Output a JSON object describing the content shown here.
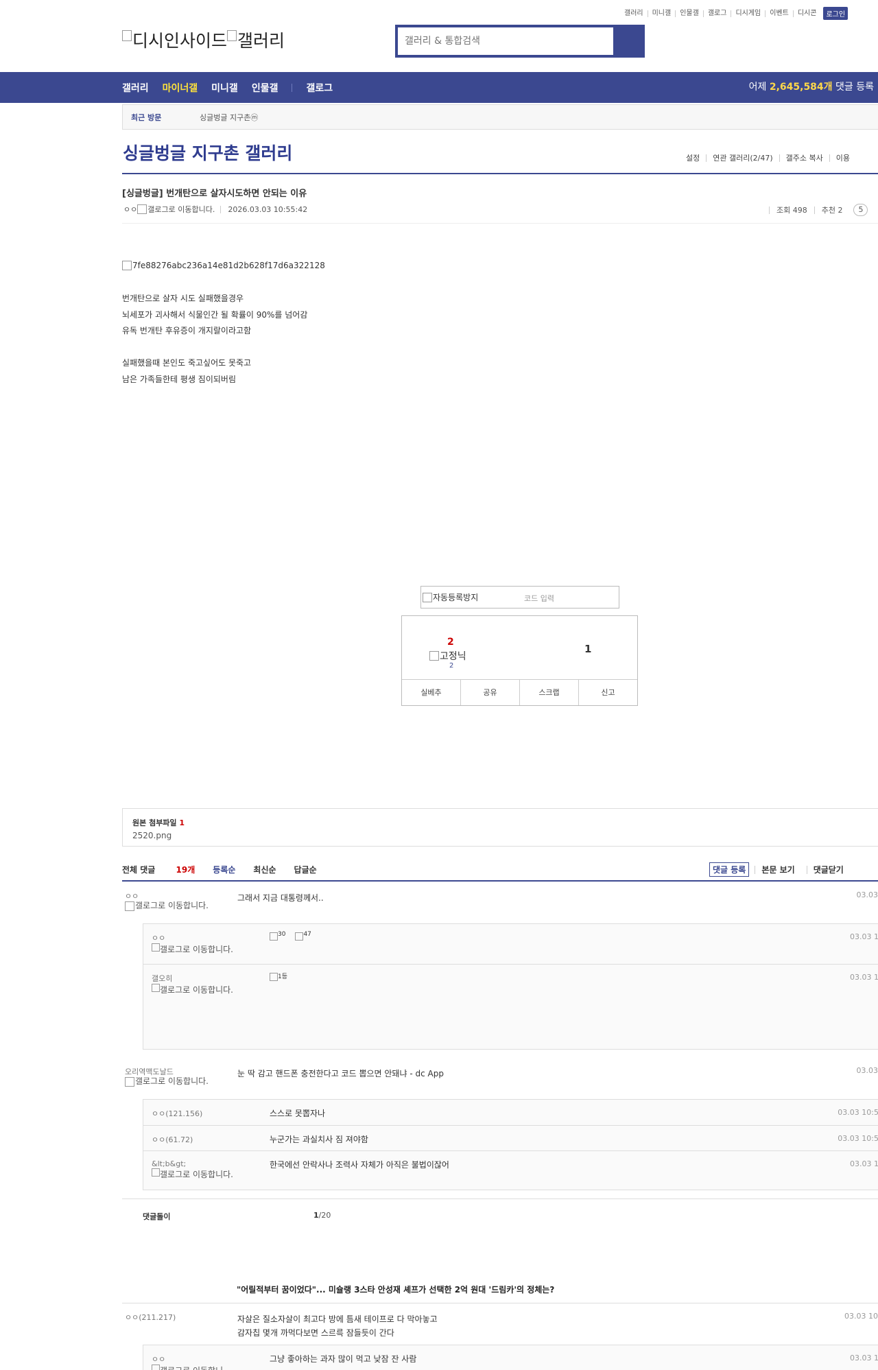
{
  "util": {
    "items": [
      "갤러리",
      "미니갤",
      "인물갤",
      "갤로그",
      "디시게임",
      "이벤트",
      "디시콘"
    ],
    "login": "로그인"
  },
  "logo": {
    "left": "디시인사이드",
    "right": "갤러리"
  },
  "search": {
    "placeholder": "갤러리 & 통합검색"
  },
  "gnb": {
    "items": [
      "갤러리",
      "마이너갤",
      "미니갤",
      "인물갤",
      "갤로그"
    ],
    "count_prefix": "어제",
    "count_value": "2,645,584개",
    "count_suffix": "댓글 등록"
  },
  "recent": {
    "label": "최근 방문",
    "value": "싱글벙글 지구촌",
    "badge": "ⓜ"
  },
  "gallery": {
    "title": "싱글벙글 지구촌 갤러리",
    "opts": [
      "설정",
      "연관 갤러리(2/47)",
      "갤주소 복사",
      "이용"
    ]
  },
  "post": {
    "title": "[싱글벙글] 번개탄으로 살자시도하면 안되는 이유",
    "author": "ㅇㅇ",
    "author_img_alt": "갤로그로 이동합니다.",
    "date": "2026.03.03 10:55:42",
    "views": "조회 498",
    "recommend": "추천 2",
    "comments_badge": "5",
    "image_alt": "7fe88276abc236a14e81d2b628f17d6a322128",
    "lines": [
      "번개탄으로 살자 시도 실패했을경우",
      "뇌세포가 괴사해서 식물인간 될 확률이 90%를 넘어감",
      "유독 번개탄 후유증이 개지랄이라고함",
      "",
      "실패했을때 본인도 죽고싶어도 못죽고",
      "남은 가족들한테 평생 짐이되버림"
    ]
  },
  "captcha": {
    "alt": "자동등록방지",
    "placeholder": "코드 입력"
  },
  "recommend_box": {
    "up": "2",
    "fixed_alt": "고정닉",
    "fixed": "2",
    "down": "1",
    "buttons": [
      "실베추",
      "공유",
      "스크랩",
      "신고"
    ]
  },
  "attach": {
    "title": "원본 첨부파일",
    "count": "1",
    "file": "2520.png"
  },
  "comment_bar": {
    "total_label": "전체 댓글",
    "total": "19개",
    "sorts": [
      "등록순",
      "최신순",
      "답글순"
    ],
    "register": "댓글 등록",
    "view": "본문 보기",
    "close": "댓글닫기"
  },
  "comments": [
    {
      "nick": "ㅇㅇ",
      "galog": "갤로그로 이동합니다.",
      "text": "그래서 지금 대통령께서..",
      "date": "03.03",
      "replies": [
        {
          "nick": "ㅇㅇ",
          "galog": "갤로그로 이동합니다.",
          "text": "",
          "dccon": [
            "30",
            "47"
          ],
          "date": "03.03 1"
        },
        {
          "nick": "갤오히",
          "galog": "갤로그로 이동합니다.",
          "text": "",
          "dccon": [
            "1등"
          ],
          "date": "03.03 1"
        }
      ]
    },
    {
      "nick": "오리역맥도날드",
      "galog": "갤로그로 이동합니다.",
      "text": "눈 딱 감고 핸드폰 충전한다고 코드 뽑으면 안돼냐 - dc App",
      "date": "03.03",
      "replies": [
        {
          "nick": "ㅇㅇ(121.156)",
          "text": "스스로 못뽑자나",
          "date": "03.03 10:5"
        },
        {
          "nick": "ㅇㅇ(61.72)",
          "text": "누군가는 과실치사 짐 져야함",
          "date": "03.03 10:5"
        },
        {
          "nick": "&lt;b&gt;",
          "galog": "갤로그로 이동합니다.",
          "text": "한국에선 안락사나 조력사 자체가 아직은 불법이잖어",
          "date": "03.03 1"
        }
      ]
    }
  ],
  "comment_paging": {
    "label": "댓글돌이",
    "current": "1",
    "total": "/20"
  },
  "news": {
    "title": "\"어릴적부터 꿈이었다\"... 미슐랭 3스타 안성재 셰프가 선택한 2억 원대 '드림카'의 정체는?"
  },
  "comments2": [
    {
      "nick": "ㅇㅇ(211.217)",
      "line1": "자살은 질소자살이 최고다 방에 틈새 테이프로 다 막아놓고",
      "line2": "감자칩 몇개 까먹다보면 스르륵 잠들듯이 간다",
      "date": "03.03 10"
    }
  ],
  "reply3": {
    "nick": "ㅇㅇ",
    "galog": "갤로그로 이동합니",
    "text": "그냥 좋아하는 과자 많이 먹고 낮잠 잔 사람",
    "date": "03.03 1"
  }
}
